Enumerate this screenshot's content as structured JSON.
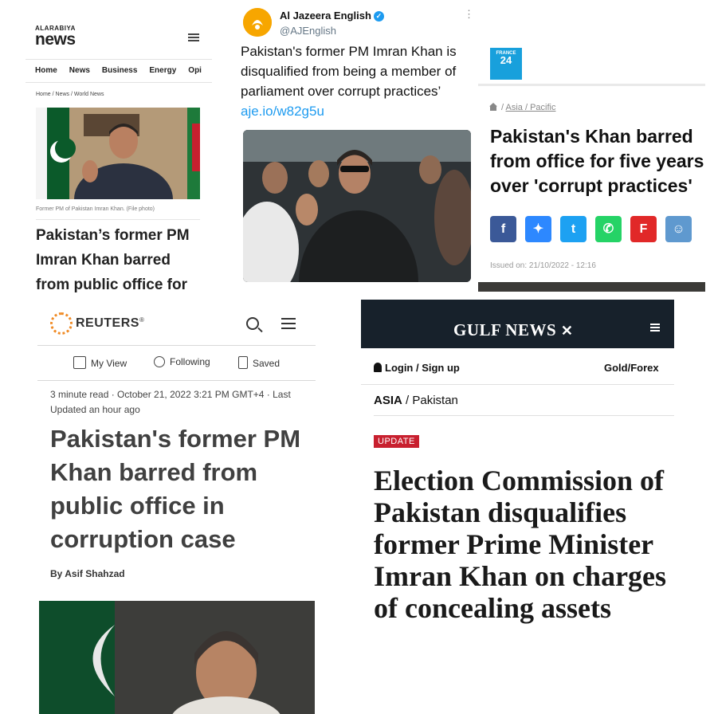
{
  "alarabiya": {
    "logo_small": "ALARABIYA",
    "logo_big": "news",
    "nav": [
      "Home",
      "News",
      "Business",
      "Energy",
      "Opi"
    ],
    "breadcrumb": "Home  /  News  /  World News",
    "caption": "Former PM of Pakistan Imran Khan. (File photo)",
    "headline": "Pakistan’s former PM Imran Khan barred from public office for"
  },
  "aljazeera": {
    "name": "Al Jazeera English",
    "handle": "@AJEnglish",
    "tweet_text": "Pakistan's former PM Imran Khan is disqualified from being a member of parliament over corrupt practices’ ",
    "tweet_link": "aje.io/w82g5u",
    "avatar_color": "#f7a600",
    "verified_color": "#1d9bf0"
  },
  "france24": {
    "logo_top": "FRANCE",
    "logo_num": "24",
    "breadcrumb": "Asia / Pacific",
    "headline_lines": [
      "Pakistan's Khan barred",
      "from office for five years",
      "over 'corrupt practices'"
    ],
    "share_icons": [
      {
        "name": "facebook-icon",
        "glyph": "f",
        "color": "#3b5998"
      },
      {
        "name": "messenger-icon",
        "glyph": "✦",
        "color": "#2d88ff"
      },
      {
        "name": "twitter-icon",
        "glyph": "t",
        "color": "#1da1f2"
      },
      {
        "name": "whatsapp-icon",
        "glyph": "✆",
        "color": "#25d366"
      },
      {
        "name": "flipboard-icon",
        "glyph": "F",
        "color": "#e12828"
      },
      {
        "name": "reddit-icon",
        "glyph": "☺",
        "color": "#5f99cf"
      }
    ],
    "issued": "Issued on: 21/10/2022 - 12:16"
  },
  "reuters": {
    "logo": "REUTERS",
    "registered": "®",
    "tabs": [
      "My View",
      "Following",
      "Saved"
    ],
    "meta": "3 minute read · October 21, 2022 3:21 PM GMT+4 · Last Updated an hour ago",
    "headline": "Pakistan's former PM Khan barred from public office in corruption case",
    "byline": "By Asif Shahzad",
    "accent": "#f08a24"
  },
  "gulfnews": {
    "logo": "GULF NEWS",
    "login": "Login / Sign up",
    "gold": "Gold/Forex",
    "crumb_section": "ASIA",
    "crumb_sub": "/ Pakistan",
    "badge": "UPDATE",
    "headline": "Election Commission of Pakistan disqualifies former Prime Minister Imran Khan on charges of concealing assets",
    "header_color": "#17212b",
    "badge_color": "#c8202f"
  }
}
